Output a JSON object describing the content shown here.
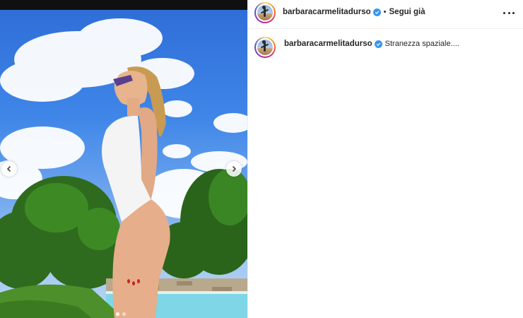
{
  "post": {
    "author": {
      "username": "barbaracarmelitadurso",
      "verified": true,
      "follow_status": "Segui già"
    },
    "caption": "Stranezza spaziale....",
    "carousel": {
      "total": 2,
      "current": 1
    },
    "icons": {
      "prev": "chevron-left-icon",
      "next": "chevron-right-icon",
      "more": "more-options-icon",
      "verified": "verified-badge-icon"
    },
    "colors": {
      "verified": "#3897f0",
      "sky": "#3f86e8",
      "pool": "#7fd6e6"
    }
  }
}
